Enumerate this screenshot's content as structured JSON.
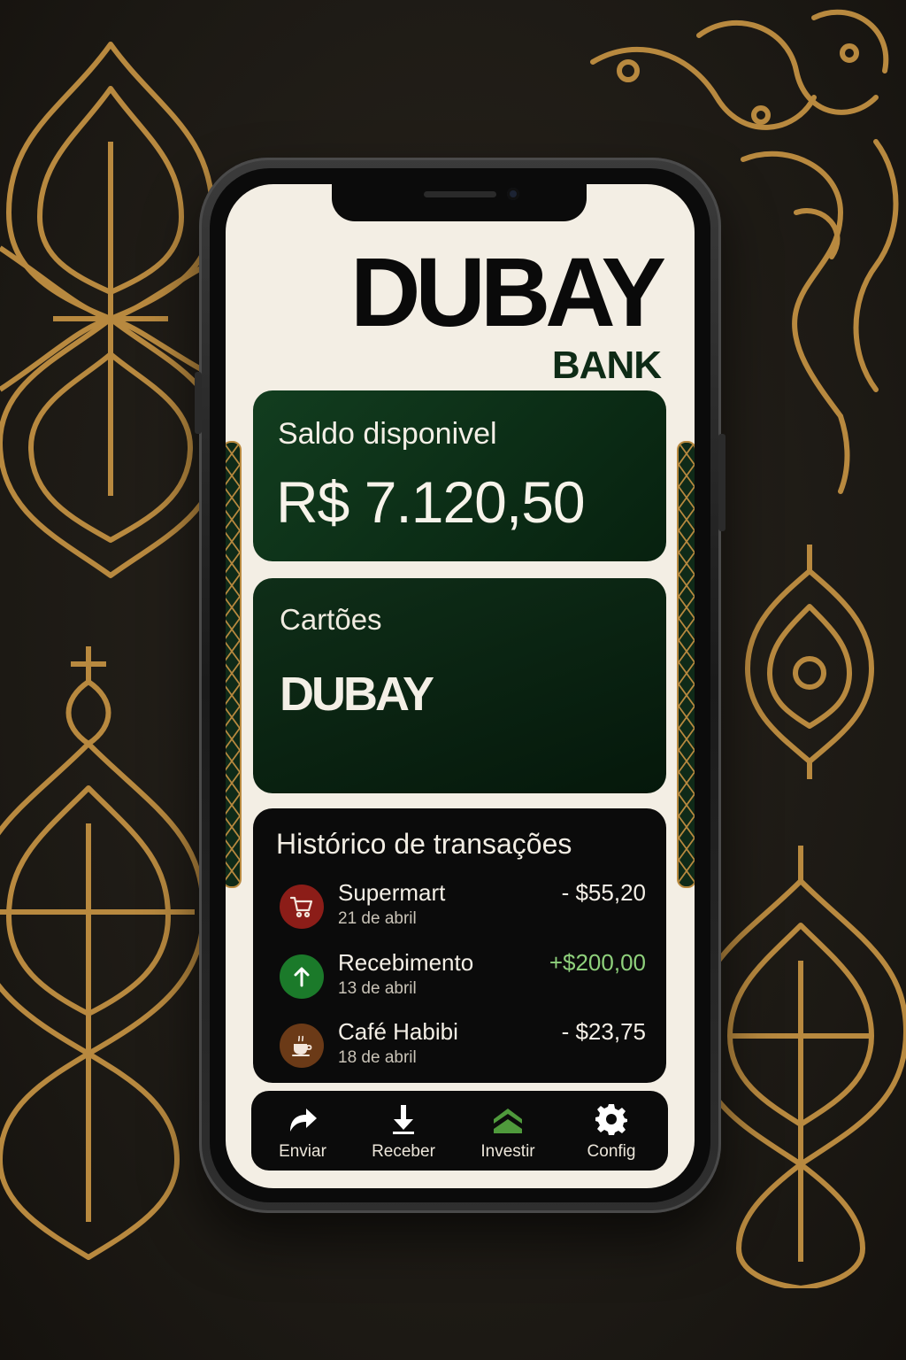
{
  "brand": {
    "name": "DUBAY",
    "sub": "BANK"
  },
  "balance": {
    "label": "Saldo disponivel",
    "value": "R$ 7.120,50"
  },
  "cards": {
    "label": "Cartões",
    "card_brand": "DUBAY"
  },
  "history": {
    "title": "Histórico de transações",
    "transactions": [
      {
        "name": "Supermart",
        "date": "21 de abril",
        "amount": "- $55,20",
        "icon": "shopping-cart-icon",
        "color": "#8c1d18"
      },
      {
        "name": "Recebimento",
        "date": "13 de abril",
        "amount": "+$200,00",
        "icon": "arrow-up-icon",
        "color": "#1b7a2a"
      },
      {
        "name": "Café Habibi",
        "date": "18 de abril",
        "amount": "- $23,75",
        "icon": "coffee-cup-icon",
        "color": "#6b3a17"
      }
    ]
  },
  "nav": {
    "items": [
      {
        "label": "Enviar",
        "icon": "share-arrow-icon"
      },
      {
        "label": "Receber",
        "icon": "download-arrow-icon"
      },
      {
        "label": "Investir",
        "icon": "chevron-up-stack-icon"
      },
      {
        "label": "Config",
        "icon": "gear-icon"
      }
    ]
  },
  "colors": {
    "accent_green": "#0e2b16",
    "positive": "#8fd17c",
    "gold": "#b8893f",
    "screen_bg": "#f3eee4"
  }
}
